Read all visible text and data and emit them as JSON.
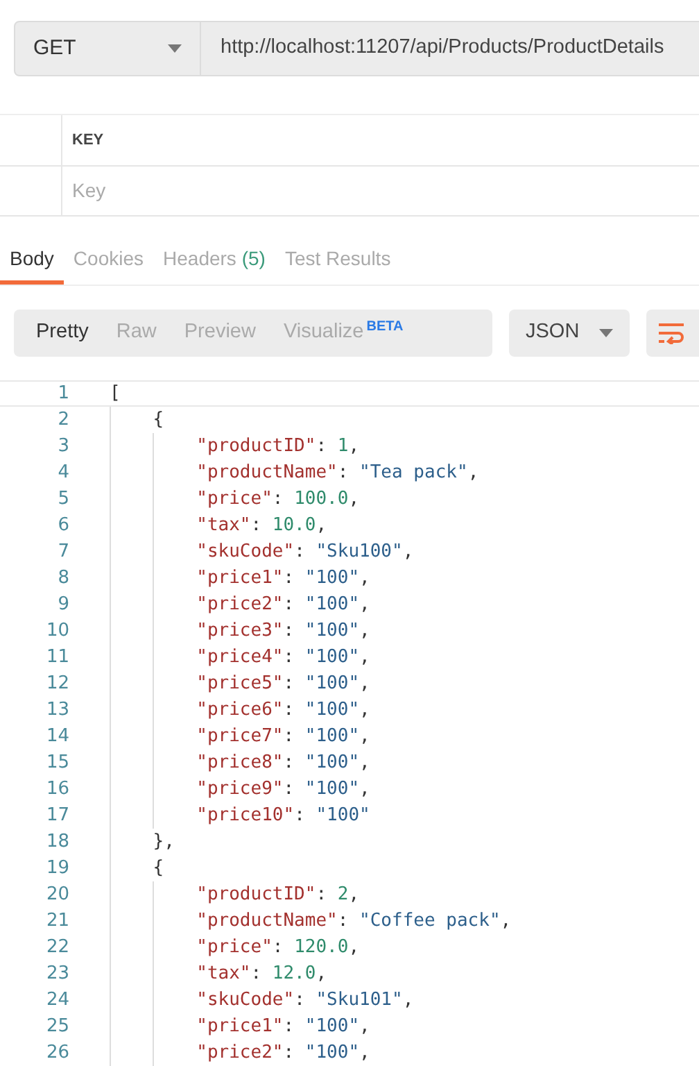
{
  "request": {
    "method": "GET",
    "url": "http://localhost:11207/api/Products/ProductDetails"
  },
  "params_table": {
    "columns": [
      "KEY"
    ],
    "placeholder": "Key"
  },
  "response_tabs": [
    {
      "label": "Body",
      "selected": true
    },
    {
      "label": "Cookies",
      "selected": false
    },
    {
      "label": "Headers",
      "count": "(5)",
      "selected": false
    },
    {
      "label": "Test Results",
      "selected": false
    }
  ],
  "view_modes": [
    {
      "label": "Pretty",
      "selected": true
    },
    {
      "label": "Raw",
      "selected": false
    },
    {
      "label": "Preview",
      "selected": false
    },
    {
      "label": "Visualize",
      "badge": "BETA",
      "selected": false
    }
  ],
  "format": "JSON",
  "code_lines": [
    {
      "n": "1",
      "tokens": [
        {
          "kind": "punct",
          "text": "["
        }
      ]
    },
    {
      "n": "2",
      "tokens": [
        {
          "kind": "punct",
          "text": "    {"
        }
      ]
    },
    {
      "n": "3",
      "tokens": [
        {
          "kind": "key",
          "text": "        \"productID\""
        },
        {
          "kind": "punct",
          "text": ": "
        },
        {
          "kind": "number",
          "text": "1"
        },
        {
          "kind": "punct",
          "text": ","
        }
      ]
    },
    {
      "n": "4",
      "tokens": [
        {
          "kind": "key",
          "text": "        \"productName\""
        },
        {
          "kind": "punct",
          "text": ": "
        },
        {
          "kind": "string",
          "text": "\"Tea pack\""
        },
        {
          "kind": "punct",
          "text": ","
        }
      ]
    },
    {
      "n": "5",
      "tokens": [
        {
          "kind": "key",
          "text": "        \"price\""
        },
        {
          "kind": "punct",
          "text": ": "
        },
        {
          "kind": "number",
          "text": "100.0"
        },
        {
          "kind": "punct",
          "text": ","
        }
      ]
    },
    {
      "n": "6",
      "tokens": [
        {
          "kind": "key",
          "text": "        \"tax\""
        },
        {
          "kind": "punct",
          "text": ": "
        },
        {
          "kind": "number",
          "text": "10.0"
        },
        {
          "kind": "punct",
          "text": ","
        }
      ]
    },
    {
      "n": "7",
      "tokens": [
        {
          "kind": "key",
          "text": "        \"skuCode\""
        },
        {
          "kind": "punct",
          "text": ": "
        },
        {
          "kind": "string",
          "text": "\"Sku100\""
        },
        {
          "kind": "punct",
          "text": ","
        }
      ]
    },
    {
      "n": "8",
      "tokens": [
        {
          "kind": "key",
          "text": "        \"price1\""
        },
        {
          "kind": "punct",
          "text": ": "
        },
        {
          "kind": "string",
          "text": "\"100\""
        },
        {
          "kind": "punct",
          "text": ","
        }
      ]
    },
    {
      "n": "9",
      "tokens": [
        {
          "kind": "key",
          "text": "        \"price2\""
        },
        {
          "kind": "punct",
          "text": ": "
        },
        {
          "kind": "string",
          "text": "\"100\""
        },
        {
          "kind": "punct",
          "text": ","
        }
      ]
    },
    {
      "n": "10",
      "tokens": [
        {
          "kind": "key",
          "text": "        \"price3\""
        },
        {
          "kind": "punct",
          "text": ": "
        },
        {
          "kind": "string",
          "text": "\"100\""
        },
        {
          "kind": "punct",
          "text": ","
        }
      ]
    },
    {
      "n": "11",
      "tokens": [
        {
          "kind": "key",
          "text": "        \"price4\""
        },
        {
          "kind": "punct",
          "text": ": "
        },
        {
          "kind": "string",
          "text": "\"100\""
        },
        {
          "kind": "punct",
          "text": ","
        }
      ]
    },
    {
      "n": "12",
      "tokens": [
        {
          "kind": "key",
          "text": "        \"price5\""
        },
        {
          "kind": "punct",
          "text": ": "
        },
        {
          "kind": "string",
          "text": "\"100\""
        },
        {
          "kind": "punct",
          "text": ","
        }
      ]
    },
    {
      "n": "13",
      "tokens": [
        {
          "kind": "key",
          "text": "        \"price6\""
        },
        {
          "kind": "punct",
          "text": ": "
        },
        {
          "kind": "string",
          "text": "\"100\""
        },
        {
          "kind": "punct",
          "text": ","
        }
      ]
    },
    {
      "n": "14",
      "tokens": [
        {
          "kind": "key",
          "text": "        \"price7\""
        },
        {
          "kind": "punct",
          "text": ": "
        },
        {
          "kind": "string",
          "text": "\"100\""
        },
        {
          "kind": "punct",
          "text": ","
        }
      ]
    },
    {
      "n": "15",
      "tokens": [
        {
          "kind": "key",
          "text": "        \"price8\""
        },
        {
          "kind": "punct",
          "text": ": "
        },
        {
          "kind": "string",
          "text": "\"100\""
        },
        {
          "kind": "punct",
          "text": ","
        }
      ]
    },
    {
      "n": "16",
      "tokens": [
        {
          "kind": "key",
          "text": "        \"price9\""
        },
        {
          "kind": "punct",
          "text": ": "
        },
        {
          "kind": "string",
          "text": "\"100\""
        },
        {
          "kind": "punct",
          "text": ","
        }
      ]
    },
    {
      "n": "17",
      "tokens": [
        {
          "kind": "key",
          "text": "        \"price10\""
        },
        {
          "kind": "punct",
          "text": ": "
        },
        {
          "kind": "string",
          "text": "\"100\""
        }
      ]
    },
    {
      "n": "18",
      "tokens": [
        {
          "kind": "punct",
          "text": "    },"
        }
      ]
    },
    {
      "n": "19",
      "tokens": [
        {
          "kind": "punct",
          "text": "    {"
        }
      ]
    },
    {
      "n": "20",
      "tokens": [
        {
          "kind": "key",
          "text": "        \"productID\""
        },
        {
          "kind": "punct",
          "text": ": "
        },
        {
          "kind": "number",
          "text": "2"
        },
        {
          "kind": "punct",
          "text": ","
        }
      ]
    },
    {
      "n": "21",
      "tokens": [
        {
          "kind": "key",
          "text": "        \"productName\""
        },
        {
          "kind": "punct",
          "text": ": "
        },
        {
          "kind": "string",
          "text": "\"Coffee pack\""
        },
        {
          "kind": "punct",
          "text": ","
        }
      ]
    },
    {
      "n": "22",
      "tokens": [
        {
          "kind": "key",
          "text": "        \"price\""
        },
        {
          "kind": "punct",
          "text": ": "
        },
        {
          "kind": "number",
          "text": "120.0"
        },
        {
          "kind": "punct",
          "text": ","
        }
      ]
    },
    {
      "n": "23",
      "tokens": [
        {
          "kind": "key",
          "text": "        \"tax\""
        },
        {
          "kind": "punct",
          "text": ": "
        },
        {
          "kind": "number",
          "text": "12.0"
        },
        {
          "kind": "punct",
          "text": ","
        }
      ]
    },
    {
      "n": "24",
      "tokens": [
        {
          "kind": "key",
          "text": "        \"skuCode\""
        },
        {
          "kind": "punct",
          "text": ": "
        },
        {
          "kind": "string",
          "text": "\"Sku101\""
        },
        {
          "kind": "punct",
          "text": ","
        }
      ]
    },
    {
      "n": "25",
      "tokens": [
        {
          "kind": "key",
          "text": "        \"price1\""
        },
        {
          "kind": "punct",
          "text": ": "
        },
        {
          "kind": "string",
          "text": "\"100\""
        },
        {
          "kind": "punct",
          "text": ","
        }
      ]
    },
    {
      "n": "26",
      "tokens": [
        {
          "kind": "key",
          "text": "        \"price2\""
        },
        {
          "kind": "punct",
          "text": ": "
        },
        {
          "kind": "string",
          "text": "\"100\""
        },
        {
          "kind": "punct",
          "text": ","
        }
      ]
    }
  ]
}
